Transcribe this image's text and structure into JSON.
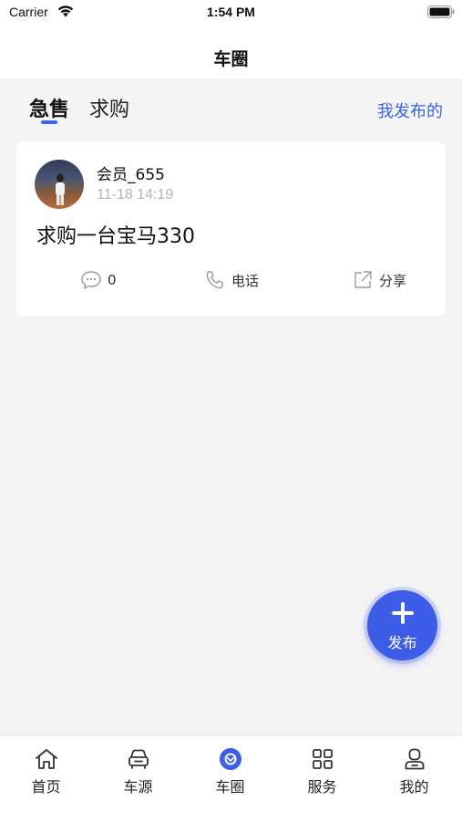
{
  "status_bar": {
    "carrier": "Carrier",
    "time": "1:54 PM"
  },
  "nav": {
    "title": "车圈"
  },
  "tabs": {
    "items": [
      "急售",
      "求购"
    ],
    "active_index": 0,
    "my_posts": "我发布的"
  },
  "post": {
    "username": "会员_655",
    "time": "11-18 14:19",
    "content": "求购一台宝马330",
    "comment_count": "0",
    "phone_label": "电话",
    "share_label": "分享"
  },
  "fab": {
    "label": "发布"
  },
  "tab_bar": {
    "items": [
      {
        "label": "首页",
        "icon": "home-icon"
      },
      {
        "label": "车源",
        "icon": "car-icon"
      },
      {
        "label": "车圈",
        "icon": "car-circle-icon"
      },
      {
        "label": "服务",
        "icon": "grid-icon"
      },
      {
        "label": "我的",
        "icon": "user-icon"
      }
    ],
    "active_index": 2
  },
  "colors": {
    "accent": "#3d5ce8",
    "link": "#3a63e6",
    "background": "#f4f4f5"
  }
}
